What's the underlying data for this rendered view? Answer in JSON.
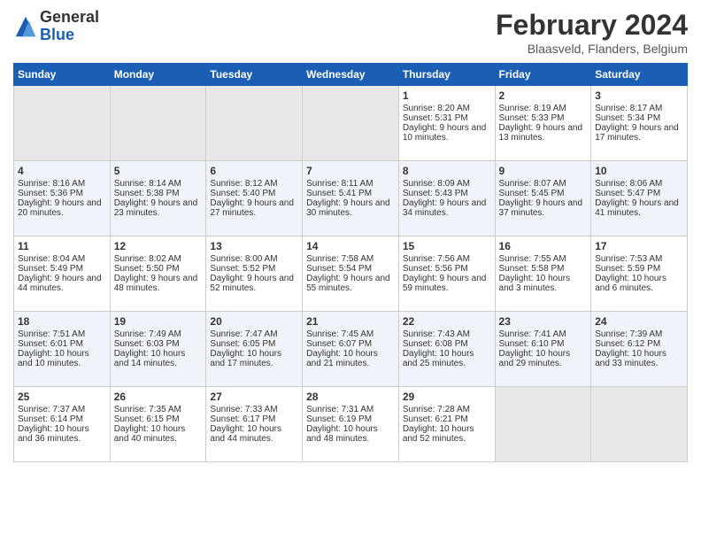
{
  "header": {
    "logo": {
      "general": "General",
      "blue": "Blue"
    },
    "month": "February 2024",
    "location": "Blaasveld, Flanders, Belgium"
  },
  "days_of_week": [
    "Sunday",
    "Monday",
    "Tuesday",
    "Wednesday",
    "Thursday",
    "Friday",
    "Saturday"
  ],
  "weeks": [
    [
      {
        "day": "",
        "empty": true
      },
      {
        "day": "",
        "empty": true
      },
      {
        "day": "",
        "empty": true
      },
      {
        "day": "",
        "empty": true
      },
      {
        "day": "1",
        "sunrise": "Sunrise: 8:20 AM",
        "sunset": "Sunset: 5:31 PM",
        "daylight": "Daylight: 9 hours and 10 minutes."
      },
      {
        "day": "2",
        "sunrise": "Sunrise: 8:19 AM",
        "sunset": "Sunset: 5:33 PM",
        "daylight": "Daylight: 9 hours and 13 minutes."
      },
      {
        "day": "3",
        "sunrise": "Sunrise: 8:17 AM",
        "sunset": "Sunset: 5:34 PM",
        "daylight": "Daylight: 9 hours and 17 minutes."
      }
    ],
    [
      {
        "day": "4",
        "sunrise": "Sunrise: 8:16 AM",
        "sunset": "Sunset: 5:36 PM",
        "daylight": "Daylight: 9 hours and 20 minutes."
      },
      {
        "day": "5",
        "sunrise": "Sunrise: 8:14 AM",
        "sunset": "Sunset: 5:38 PM",
        "daylight": "Daylight: 9 hours and 23 minutes."
      },
      {
        "day": "6",
        "sunrise": "Sunrise: 8:12 AM",
        "sunset": "Sunset: 5:40 PM",
        "daylight": "Daylight: 9 hours and 27 minutes."
      },
      {
        "day": "7",
        "sunrise": "Sunrise: 8:11 AM",
        "sunset": "Sunset: 5:41 PM",
        "daylight": "Daylight: 9 hours and 30 minutes."
      },
      {
        "day": "8",
        "sunrise": "Sunrise: 8:09 AM",
        "sunset": "Sunset: 5:43 PM",
        "daylight": "Daylight: 9 hours and 34 minutes."
      },
      {
        "day": "9",
        "sunrise": "Sunrise: 8:07 AM",
        "sunset": "Sunset: 5:45 PM",
        "daylight": "Daylight: 9 hours and 37 minutes."
      },
      {
        "day": "10",
        "sunrise": "Sunrise: 8:06 AM",
        "sunset": "Sunset: 5:47 PM",
        "daylight": "Daylight: 9 hours and 41 minutes."
      }
    ],
    [
      {
        "day": "11",
        "sunrise": "Sunrise: 8:04 AM",
        "sunset": "Sunset: 5:49 PM",
        "daylight": "Daylight: 9 hours and 44 minutes."
      },
      {
        "day": "12",
        "sunrise": "Sunrise: 8:02 AM",
        "sunset": "Sunset: 5:50 PM",
        "daylight": "Daylight: 9 hours and 48 minutes."
      },
      {
        "day": "13",
        "sunrise": "Sunrise: 8:00 AM",
        "sunset": "Sunset: 5:52 PM",
        "daylight": "Daylight: 9 hours and 52 minutes."
      },
      {
        "day": "14",
        "sunrise": "Sunrise: 7:58 AM",
        "sunset": "Sunset: 5:54 PM",
        "daylight": "Daylight: 9 hours and 55 minutes."
      },
      {
        "day": "15",
        "sunrise": "Sunrise: 7:56 AM",
        "sunset": "Sunset: 5:56 PM",
        "daylight": "Daylight: 9 hours and 59 minutes."
      },
      {
        "day": "16",
        "sunrise": "Sunrise: 7:55 AM",
        "sunset": "Sunset: 5:58 PM",
        "daylight": "Daylight: 10 hours and 3 minutes."
      },
      {
        "day": "17",
        "sunrise": "Sunrise: 7:53 AM",
        "sunset": "Sunset: 5:59 PM",
        "daylight": "Daylight: 10 hours and 6 minutes."
      }
    ],
    [
      {
        "day": "18",
        "sunrise": "Sunrise: 7:51 AM",
        "sunset": "Sunset: 6:01 PM",
        "daylight": "Daylight: 10 hours and 10 minutes."
      },
      {
        "day": "19",
        "sunrise": "Sunrise: 7:49 AM",
        "sunset": "Sunset: 6:03 PM",
        "daylight": "Daylight: 10 hours and 14 minutes."
      },
      {
        "day": "20",
        "sunrise": "Sunrise: 7:47 AM",
        "sunset": "Sunset: 6:05 PM",
        "daylight": "Daylight: 10 hours and 17 minutes."
      },
      {
        "day": "21",
        "sunrise": "Sunrise: 7:45 AM",
        "sunset": "Sunset: 6:07 PM",
        "daylight": "Daylight: 10 hours and 21 minutes."
      },
      {
        "day": "22",
        "sunrise": "Sunrise: 7:43 AM",
        "sunset": "Sunset: 6:08 PM",
        "daylight": "Daylight: 10 hours and 25 minutes."
      },
      {
        "day": "23",
        "sunrise": "Sunrise: 7:41 AM",
        "sunset": "Sunset: 6:10 PM",
        "daylight": "Daylight: 10 hours and 29 minutes."
      },
      {
        "day": "24",
        "sunrise": "Sunrise: 7:39 AM",
        "sunset": "Sunset: 6:12 PM",
        "daylight": "Daylight: 10 hours and 33 minutes."
      }
    ],
    [
      {
        "day": "25",
        "sunrise": "Sunrise: 7:37 AM",
        "sunset": "Sunset: 6:14 PM",
        "daylight": "Daylight: 10 hours and 36 minutes."
      },
      {
        "day": "26",
        "sunrise": "Sunrise: 7:35 AM",
        "sunset": "Sunset: 6:15 PM",
        "daylight": "Daylight: 10 hours and 40 minutes."
      },
      {
        "day": "27",
        "sunrise": "Sunrise: 7:33 AM",
        "sunset": "Sunset: 6:17 PM",
        "daylight": "Daylight: 10 hours and 44 minutes."
      },
      {
        "day": "28",
        "sunrise": "Sunrise: 7:31 AM",
        "sunset": "Sunset: 6:19 PM",
        "daylight": "Daylight: 10 hours and 48 minutes."
      },
      {
        "day": "29",
        "sunrise": "Sunrise: 7:28 AM",
        "sunset": "Sunset: 6:21 PM",
        "daylight": "Daylight: 10 hours and 52 minutes."
      },
      {
        "day": "",
        "empty": true
      },
      {
        "day": "",
        "empty": true
      }
    ]
  ]
}
